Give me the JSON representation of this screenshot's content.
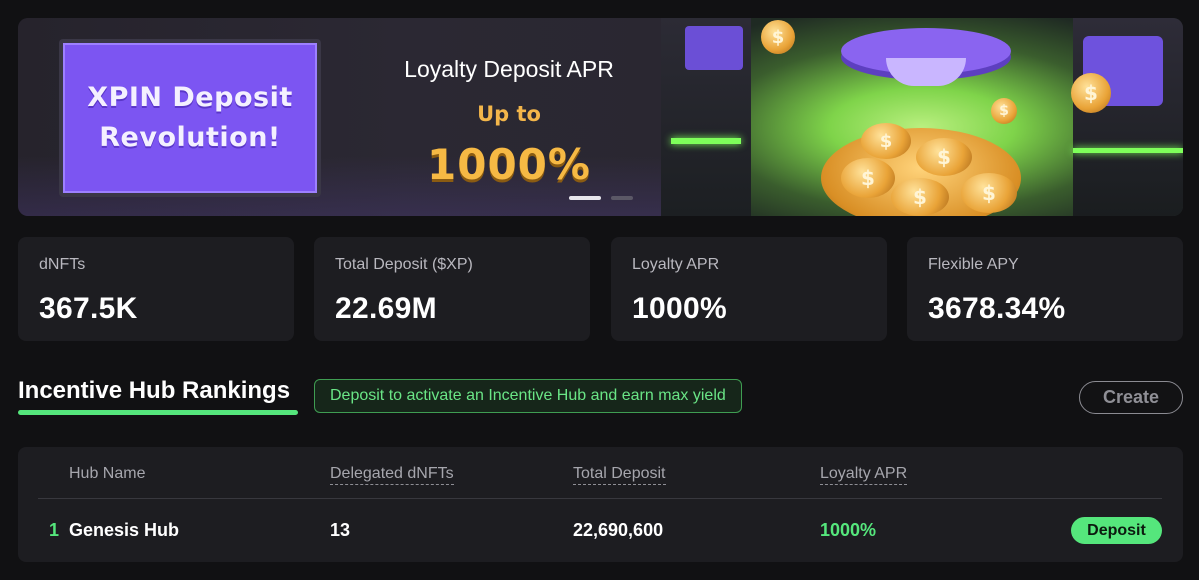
{
  "banner": {
    "screen_title": "XPIN Deposit Revolution!",
    "apr_title": "Loyalty Deposit APR",
    "apr_upto": "Up to",
    "apr_value": "1000%",
    "slides": {
      "total": 2,
      "active": 1
    },
    "coin_symbol": "$",
    "colors": {
      "accent_purple": "#7c55f2",
      "gold": "#f6b944",
      "green_glow": "#7eff5a"
    }
  },
  "stats": [
    {
      "label": "dNFTs",
      "value": "367.5K"
    },
    {
      "label": "Total Deposit ($XP)",
      "value": "22.69M"
    },
    {
      "label": "Loyalty APR",
      "value": "1000%"
    },
    {
      "label": "Flexible APY",
      "value": "3678.34%"
    }
  ],
  "rankings": {
    "title": "Incentive Hub Rankings",
    "hint": "Deposit to activate an Incentive Hub and earn max yield",
    "create_label": "Create",
    "columns": [
      "Hub Name",
      "Delegated dNFTs",
      "Total Deposit",
      "Loyalty APR"
    ],
    "rows": [
      {
        "rank": "1",
        "name": "Genesis Hub",
        "delegated": "13",
        "total_deposit": "22,690,600",
        "apr": "1000%",
        "action": "Deposit"
      }
    ]
  },
  "colors": {
    "accent_green": "#55e67c",
    "card_bg": "#1d1d21",
    "page_bg": "#111113"
  }
}
